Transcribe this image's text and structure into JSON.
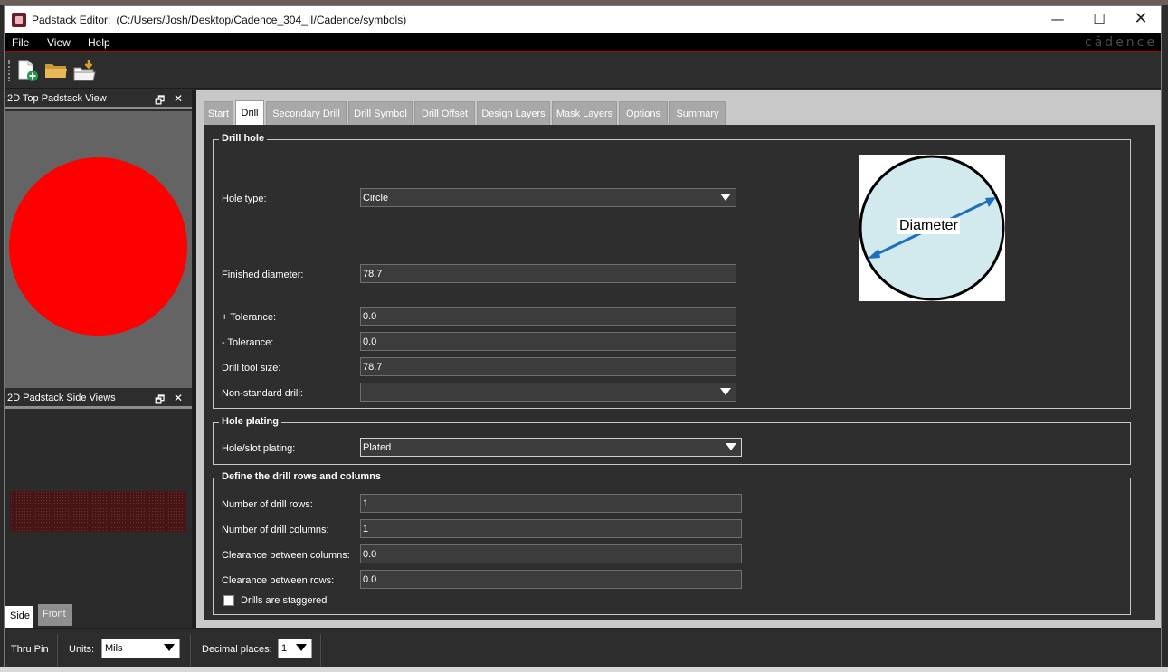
{
  "window": {
    "app_title": "Padstack Editor:",
    "file_path": "(C:/Users/Josh/Desktop/Cadence_304_II/Cadence/symbols)"
  },
  "window_controls": {
    "minimize": "—",
    "maximize": "☐",
    "close": "✕"
  },
  "menu": {
    "file": "File",
    "view": "View",
    "help": "Help"
  },
  "brand": "cādence",
  "toolbar": {
    "icons": [
      "new-file-icon",
      "open-folder-icon",
      "import-folder-icon"
    ]
  },
  "left_panel": {
    "top_view_title": "2D Top Padstack View",
    "side_view_title": "2D Padstack Side Views",
    "panel_controls": {
      "float": "🗗",
      "close": "✕"
    },
    "pad_color": "#ff0000",
    "side_tabs": {
      "side": "Side",
      "front": "Front"
    }
  },
  "tabs": {
    "items": [
      "Start",
      "Drill",
      "Secondary Drill",
      "Drill Symbol",
      "Drill Offset",
      "Design Layers",
      "Mask Layers",
      "Options",
      "Summary"
    ],
    "active": "Drill"
  },
  "drill_hole": {
    "title": "Drill hole",
    "hole_type": {
      "label": "Hole type:",
      "value": "Circle"
    },
    "finished_diameter": {
      "label": "Finished diameter:",
      "value": "78.7"
    },
    "plus_tolerance": {
      "label": "+ Tolerance:",
      "value": "0.0"
    },
    "minus_tolerance": {
      "label": "- Tolerance:",
      "value": "0.0"
    },
    "drill_tool_size": {
      "label": "Drill tool size:",
      "value": "78.7"
    },
    "non_standard_drill": {
      "label": "Non-standard drill:",
      "value": ""
    },
    "diagram_label": "Diameter",
    "diagram_colors": {
      "fill": "#d2e9ee",
      "arrow": "#1f6fbf"
    }
  },
  "hole_plating": {
    "title": "Hole plating",
    "label": "Hole/slot plating:",
    "value": "Plated"
  },
  "drill_rows": {
    "title": "Define the drill rows and columns",
    "rows": {
      "label": "Number of drill rows:",
      "value": "1"
    },
    "columns": {
      "label": "Number of drill columns:",
      "value": "1"
    },
    "clearance_columns": {
      "label": "Clearance between columns:",
      "value": "0.0"
    },
    "clearance_rows": {
      "label": "Clearance between rows:",
      "value": "0.0"
    },
    "staggered": {
      "label": "Drills are staggered",
      "checked": false
    }
  },
  "status": {
    "mode": "Thru Pin",
    "units_label": "Units:",
    "units_value": "Mils",
    "decimal_label": "Decimal places:",
    "decimal_value": "1"
  }
}
